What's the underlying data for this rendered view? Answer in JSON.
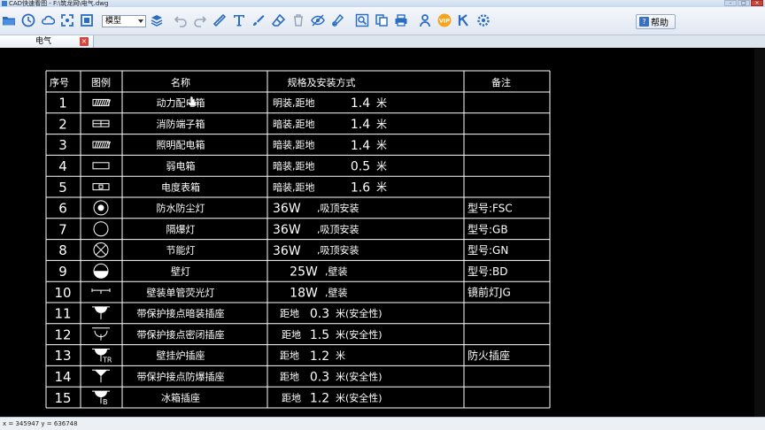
{
  "window": {
    "title": "CAD快速看图 - F:\\筑龙网\\电气.dwg"
  },
  "toolbar": {
    "layout_select": "模型",
    "help_label": "帮助",
    "vip_label": "VIP"
  },
  "tabs": [
    {
      "label": "电气"
    }
  ],
  "table": {
    "headers": {
      "no": "序号",
      "legend": "图例",
      "name": "名称",
      "spec": "规格及安装方式",
      "note": "备注"
    },
    "rows": [
      {
        "no": "1",
        "name": "动力配电箱",
        "spec_a": "明装,距地",
        "spec_b": "1.4",
        "spec_c": "米",
        "note": ""
      },
      {
        "no": "2",
        "name": "消防端子箱",
        "spec_a": "暗装,距地",
        "spec_b": "1.4",
        "spec_c": "米",
        "note": ""
      },
      {
        "no": "3",
        "name": "照明配电箱",
        "spec_a": "暗装,距地",
        "spec_b": "1.4",
        "spec_c": "米",
        "note": ""
      },
      {
        "no": "4",
        "name": "弱电箱",
        "spec_a": "暗装,距地",
        "spec_b": "0.5",
        "spec_c": "米",
        "note": ""
      },
      {
        "no": "5",
        "name": "电度表箱",
        "spec_a": "暗装,距地",
        "spec_b": "1.6",
        "spec_c": "米",
        "note": ""
      },
      {
        "no": "6",
        "name": "防水防尘灯",
        "spec_a": "36W",
        "spec_b": ",吸顶安装",
        "spec_c": "",
        "note": "型号:FSC"
      },
      {
        "no": "7",
        "name": "隔爆灯",
        "spec_a": "36W",
        "spec_b": ",吸顶安装",
        "spec_c": "",
        "note": "型号:GB"
      },
      {
        "no": "8",
        "name": "节能灯",
        "spec_a": "36W",
        "spec_b": ",吸顶安装",
        "spec_c": "",
        "note": "型号:GN"
      },
      {
        "no": "9",
        "name": "壁灯",
        "spec_a": "25W",
        "spec_b": ",壁装",
        "spec_c": "",
        "note": "型号:BD"
      },
      {
        "no": "10",
        "name": "壁装单管荧光灯",
        "spec_a": "18W",
        "spec_b": ",壁装",
        "spec_c": "",
        "note": "镜前灯JG"
      },
      {
        "no": "11",
        "name": "带保护接点暗装插座",
        "spec_a": "距地",
        "spec_b": "0.3",
        "spec_c": "米(安全性)",
        "note": ""
      },
      {
        "no": "12",
        "name": "带保护接点密闭插座",
        "spec_a": "距地",
        "spec_b": "1.5",
        "spec_c": "米(安全性)",
        "note": ""
      },
      {
        "no": "13",
        "name": "壁挂炉插座",
        "spec_a": "距地",
        "spec_b": "1.2",
        "spec_c": "米",
        "note": "防火插座"
      },
      {
        "no": "14",
        "name": "带保护接点防爆插座",
        "spec_a": "距地",
        "spec_b": "0.3",
        "spec_c": "米(安全性)",
        "note": ""
      },
      {
        "no": "15",
        "name": "冰箱插座",
        "spec_a": "距地",
        "spec_b": "1.2",
        "spec_c": "米(安全性)",
        "note": ""
      }
    ],
    "legend_symbols": [
      "panel-hatched",
      "panel-grid",
      "panel-hatched",
      "panel-empty",
      "panel-meter",
      "circle-dot",
      "circle-empty",
      "circle-cross",
      "half-circle",
      "fluorescent-wall",
      "socket-filled",
      "socket-outline",
      "socket-tr",
      "socket-ex",
      "socket-b"
    ],
    "legend_subscripts": {
      "13": "TR",
      "15": "B"
    }
  },
  "status": {
    "coords": "x = 345947  y = 636748"
  },
  "colors": {
    "canvas": "#000000",
    "lines": "#ffffff",
    "toolbar_icon": "#2a6cc4"
  }
}
